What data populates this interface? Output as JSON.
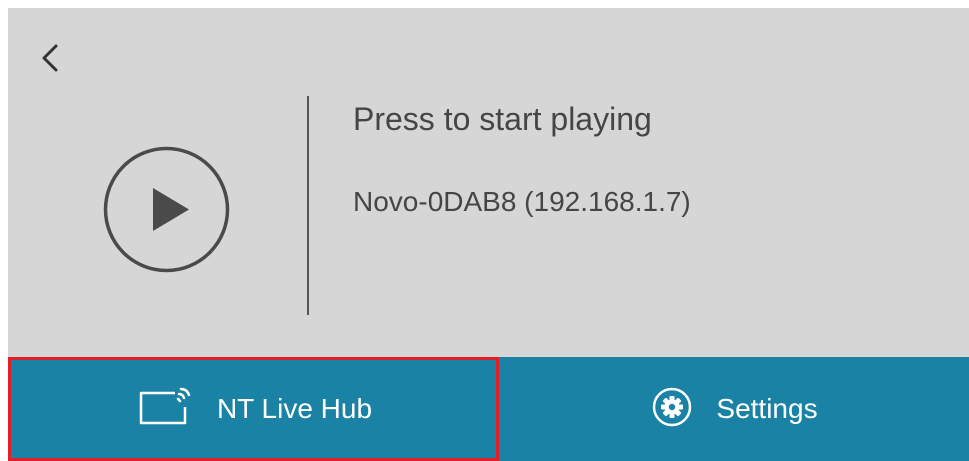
{
  "header": {
    "back_icon": "chevron-left-icon"
  },
  "player": {
    "play_icon": "play-circle-icon",
    "title": "Press to start playing",
    "device": "Novo-0DAB8 (192.168.1.7)"
  },
  "bottom_bar": {
    "tabs": [
      {
        "label": "NT Live Hub",
        "icon": "cast-screen-icon",
        "highlighted": true
      },
      {
        "label": "Settings",
        "icon": "gear-icon",
        "highlighted": false
      }
    ]
  },
  "colors": {
    "panel_background": "#d6d6d6",
    "bar_background": "#1a82a5",
    "highlight_border": "#e21e26",
    "text_dark": "#454545",
    "text_light": "#ffffff"
  }
}
